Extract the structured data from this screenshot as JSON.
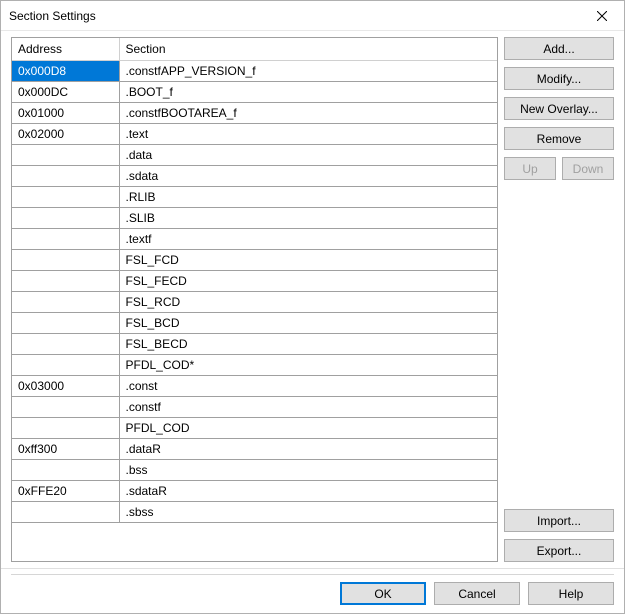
{
  "title": "Section Settings",
  "columns": {
    "address": "Address",
    "section": "Section"
  },
  "rows": [
    {
      "address": "0x000D8",
      "section": ".constfAPP_VERSION_f",
      "selected": true
    },
    {
      "address": "0x000DC",
      "section": ".BOOT_f"
    },
    {
      "address": "0x01000",
      "section": ".constfBOOTAREA_f"
    },
    {
      "address": "0x02000",
      "section": ".text"
    },
    {
      "address": "",
      "section": ".data"
    },
    {
      "address": "",
      "section": ".sdata"
    },
    {
      "address": "",
      "section": ".RLIB"
    },
    {
      "address": "",
      "section": ".SLIB"
    },
    {
      "address": "",
      "section": ".textf"
    },
    {
      "address": "",
      "section": "FSL_FCD"
    },
    {
      "address": "",
      "section": "FSL_FECD"
    },
    {
      "address": "",
      "section": "FSL_RCD"
    },
    {
      "address": "",
      "section": "FSL_BCD"
    },
    {
      "address": "",
      "section": "FSL_BECD"
    },
    {
      "address": "",
      "section": "PFDL_COD*"
    },
    {
      "address": "0x03000",
      "section": ".const"
    },
    {
      "address": "",
      "section": ".constf"
    },
    {
      "address": "",
      "section": "PFDL_COD"
    },
    {
      "address": "0xff300",
      "section": ".dataR"
    },
    {
      "address": "",
      "section": ".bss"
    },
    {
      "address": "0xFFE20",
      "section": ".sdataR"
    },
    {
      "address": "",
      "section": ".sbss"
    }
  ],
  "buttons": {
    "add": "Add...",
    "modify": "Modify...",
    "new_overlay": "New Overlay...",
    "remove": "Remove",
    "up": "Up",
    "down": "Down",
    "import": "Import...",
    "export": "Export...",
    "ok": "OK",
    "cancel": "Cancel",
    "help": "Help"
  },
  "up_down_enabled": false
}
